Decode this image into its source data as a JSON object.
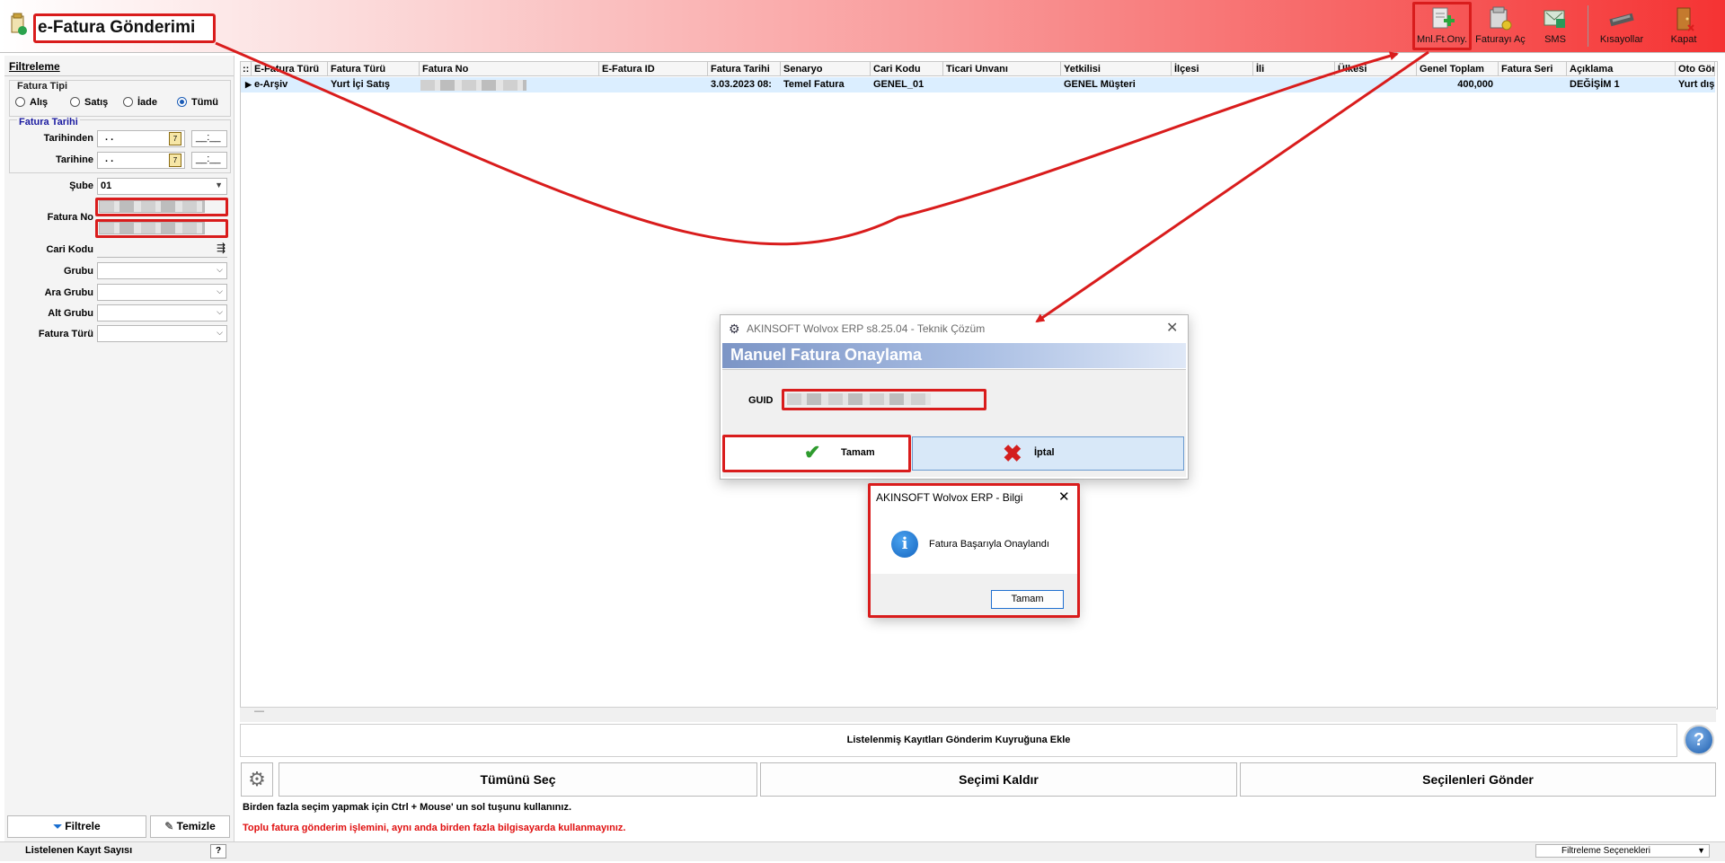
{
  "header": {
    "title": "e-Fatura Gönderimi",
    "toolbar": [
      {
        "label": "Mnl.Ft.Ony.",
        "icon": "manual-approve-icon"
      },
      {
        "label": "Faturayı Aç",
        "icon": "open-invoice-icon"
      },
      {
        "label": "SMS",
        "icon": "sms-icon"
      },
      {
        "label": "Kısayollar",
        "icon": "keyboard-icon"
      },
      {
        "label": "Kapat",
        "icon": "exit-door-icon"
      }
    ]
  },
  "filter": {
    "tab": "Filtreleme",
    "invoice_type_title": "Fatura Tipi",
    "invoice_types": [
      "Alış",
      "Satış",
      "İade",
      "Tümü"
    ],
    "selected_type": "Tümü",
    "date_group_title": "Fatura Tarihi",
    "from_label": "Tarihinden",
    "to_label": "Tarihine",
    "date_value": " . .",
    "time_value": "__:__",
    "branch_label": "Şube",
    "branch_value": "01",
    "invoice_no_label": "Fatura No",
    "customer_code_label": "Cari Kodu",
    "group_label": "Grubu",
    "subgroup_label": "Ara Grubu",
    "lower_group_label": "Alt Grubu",
    "invoice_kind_label": "Fatura Türü",
    "filter_button": "Filtrele",
    "clear_button": "Temizle"
  },
  "grid": {
    "columns": [
      "E-Fatura Türü",
      "Fatura Türü",
      "Fatura No",
      "E-Fatura ID",
      "Fatura Tarihi",
      "Senaryo",
      "Cari Kodu",
      "Ticari Unvanı",
      "Yetkilisi",
      "İlçesi",
      "İli",
      "Ülkesi",
      "Genel Toplam",
      "Fatura Seri",
      "Açıklama",
      "Oto Gön"
    ],
    "rows": [
      {
        "efatura_turu": "e-Arşiv",
        "fatura_turu": "Yurt İçi Satış",
        "fatura_no": "",
        "efatura_id": "",
        "tarih": "3.03.2023 08:",
        "senaryo": "Temel Fatura",
        "cari_kodu": "GENEL_01",
        "unvan": "",
        "yetkili": "GENEL Müşteri",
        "ilce": "",
        "il": "",
        "ulke": "",
        "genel_toplam": "400,000",
        "seri": "DEĞİŞİM 1",
        "aciklama": "Yurt dışı"
      }
    ]
  },
  "bottom": {
    "queue_label": "Listelenmiş Kayıtları Gönderim Kuyruğuna Ekle",
    "select_all": "Tümünü Seç",
    "deselect": "Seçimi Kaldır",
    "send_selected": "Seçilenleri Gönder",
    "note1": "Birden fazla seçim yapmak için Ctrl + Mouse' un sol tuşunu kullanınız.",
    "note2": "Toplu fatura gönderim işlemini, aynı anda birden fazla bilgisayarda kullanmayınız."
  },
  "status": {
    "record_count_label": "Listelenen Kayıt Sayısı",
    "help": "?",
    "filter_options": "Filtreleme Seçenekleri"
  },
  "dialog_manual": {
    "window_title": "AKINSOFT Wolvox ERP s8.25.04 - Teknik Çözüm",
    "heading": "Manuel Fatura Onaylama",
    "guid_label": "GUID",
    "ok": "Tamam",
    "cancel": "İptal"
  },
  "dialog_info": {
    "window_title": "AKINSOFT Wolvox ERP - Bilgi",
    "message": "Fatura Başarıyla Onaylandı",
    "ok": "Tamam"
  },
  "colors": {
    "annotation_red": "#d91c1c",
    "selected_row": "#dbeeff",
    "dialog_band": "#7c95c6",
    "note_red": "#e01010"
  }
}
